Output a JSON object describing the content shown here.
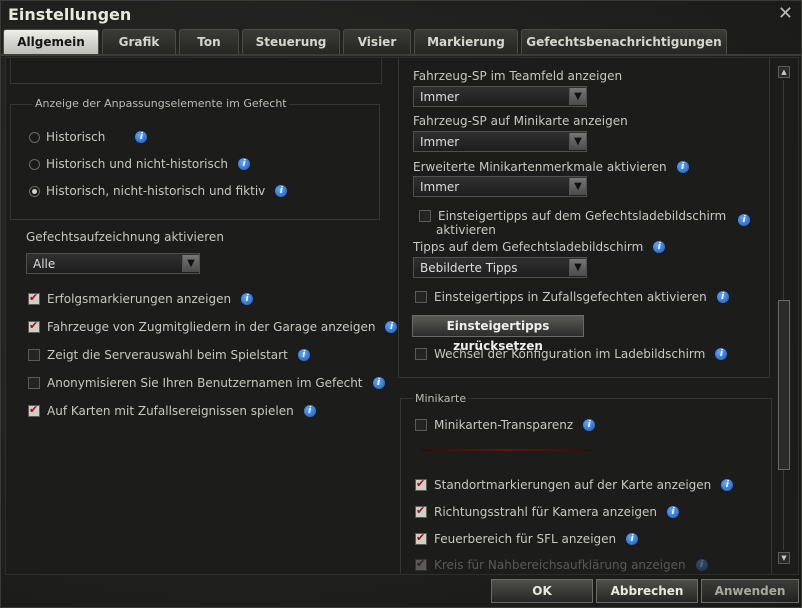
{
  "window": {
    "title": "Einstellungen",
    "close_glyph": "✕"
  },
  "tabs": [
    {
      "label": "Allgemein",
      "active": true
    },
    {
      "label": "Grafik"
    },
    {
      "label": "Ton"
    },
    {
      "label": "Steuerung"
    },
    {
      "label": "Visier"
    },
    {
      "label": "Markierung"
    },
    {
      "label": "Gefechtsbenachrichtigungen"
    }
  ],
  "left": {
    "custom_group": {
      "title": "Anzeige der Anpassungselemente im Gefecht",
      "options": [
        {
          "label": "Historisch",
          "selected": false
        },
        {
          "label": "Historisch und nicht-historisch",
          "selected": false
        },
        {
          "label": "Historisch, nicht-historisch und fiktiv",
          "selected": true
        }
      ]
    },
    "recording": {
      "label": "Gefechtsaufzeichnung aktivieren",
      "value": "Alle"
    },
    "checkboxes": [
      {
        "label": "Erfolgsmarkierungen anzeigen",
        "checked": true
      },
      {
        "label": "Fahrzeuge von Zugmitgliedern in der Garage anzeigen",
        "checked": true
      },
      {
        "label": "Zeigt die Serverauswahl beim Spielstart",
        "checked": false
      },
      {
        "label": "Anonymisieren Sie Ihren Benutzernamen im Gefecht",
        "checked": false
      },
      {
        "label": "Auf Karten mit Zufallsereignissen spielen",
        "checked": true
      }
    ]
  },
  "right": {
    "hp_team": {
      "label": "Fahrzeug-SP im Teamfeld anzeigen",
      "value": "Immer"
    },
    "hp_minimap": {
      "label": "Fahrzeug-SP auf Minikarte anzeigen",
      "value": "Immer"
    },
    "ext_minimap": {
      "label": "Erweiterte Minikartenmerkmale aktivieren",
      "value": "Immer"
    },
    "beginner_tips_loading": {
      "label_line1": "Einsteigertipps auf dem Gefechtsladebildschirm",
      "label_line2": "aktivieren",
      "checked": false
    },
    "loading_tips": {
      "label": "Tipps auf dem Gefechtsladebildschirm",
      "value": "Bebilderte Tipps"
    },
    "beginner_tips_random": {
      "label": "Einsteigertipps in Zufallsgefechten aktivieren",
      "checked": false
    },
    "reset_button": "Einsteigertipps zurücksetzen",
    "config_switch": {
      "label": "Wechsel der Konfiguration im Ladebildschirm",
      "checked": false
    },
    "minimap_group": {
      "title": "Minikarte",
      "transparency": {
        "label": "Minikarten-Transparenz",
        "checked": false
      },
      "items": [
        {
          "label": "Standortmarkierungen auf der Karte anzeigen",
          "checked": true
        },
        {
          "label": "Richtungsstrahl für Kamera anzeigen",
          "checked": true
        },
        {
          "label": "Feuerbereich für SFL anzeigen",
          "checked": true
        },
        {
          "label": "Kreis für Nahbereichsaufklärung anzeigen",
          "checked": true
        }
      ]
    }
  },
  "footer": {
    "ok": "OK",
    "cancel": "Abbrechen",
    "apply": "Anwenden"
  },
  "icons": {
    "info": "i",
    "dropdown_arrow": "▼",
    "scroll_up": "▲",
    "scroll_down": "▼"
  }
}
